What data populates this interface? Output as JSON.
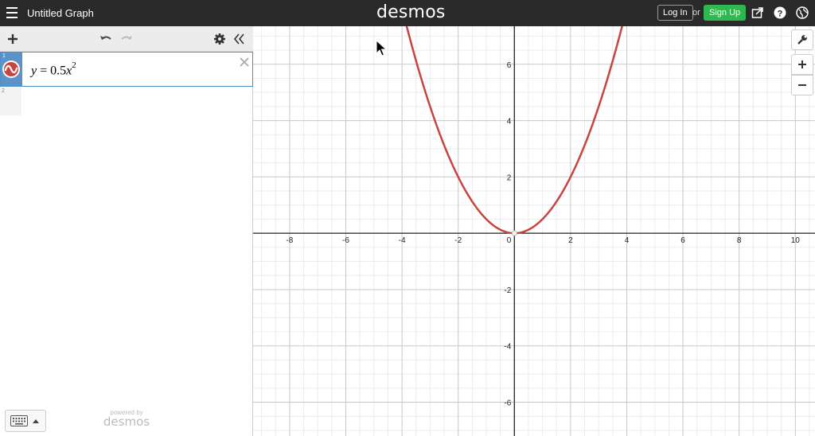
{
  "header": {
    "title": "Untitled Graph",
    "brand": "desmos",
    "login_label": "Log In",
    "or_text": "or",
    "signup_label": "Sign Up",
    "accent": "#2fb84f",
    "bar_color": "#2a2a2a",
    "icons": [
      "menu-icon",
      "share-icon",
      "help-icon",
      "language-icon"
    ]
  },
  "sidebar": {
    "toolbar_icons": [
      "add-icon",
      "undo-icon",
      "redo-icon",
      "settings-icon",
      "collapse-icon"
    ],
    "expressions": [
      {
        "index": "1",
        "lhs": "y",
        "coefficient": "0.5",
        "variable": "x",
        "exponent": "2",
        "color": "#c74440"
      },
      {
        "index": "2"
      }
    ],
    "powered_by_small": "powered by",
    "powered_by_brand": "desmos"
  },
  "graph_controls": [
    "wrench-icon",
    "zoom-in-icon",
    "zoom-out-icon"
  ],
  "chart_data": {
    "type": "line",
    "function": "y = 0.5x^2",
    "series": [
      {
        "coefficient": 0.5,
        "color": "#c74440"
      }
    ],
    "xlim": [
      -9.3,
      10.7
    ],
    "ylim": [
      -7.2,
      7.35
    ],
    "x_ticks": [
      "-8",
      "-6",
      "-4",
      "-2",
      "2",
      "4",
      "6",
      "8",
      "10"
    ],
    "y_ticks": [
      "6",
      "4",
      "2",
      "-2",
      "-4",
      "-6"
    ],
    "origin_label": "0",
    "grid": true
  }
}
